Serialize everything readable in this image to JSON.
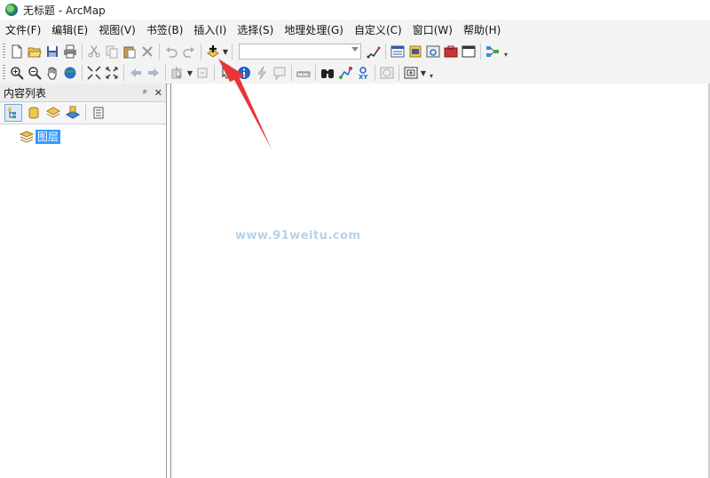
{
  "window": {
    "title": "无标题 - ArcMap",
    "app_icon": "arcmap-globe-icon"
  },
  "menubar": {
    "items": [
      "文件(F)",
      "编辑(E)",
      "视图(V)",
      "书签(B)",
      "插入(I)",
      "选择(S)",
      "地理处理(G)",
      "自定义(C)",
      "窗口(W)",
      "帮助(H)"
    ]
  },
  "toolbar_standard": {
    "scale_value": "",
    "icons": [
      "new-document-icon",
      "open-icon",
      "save-icon",
      "print-icon",
      "cut-icon",
      "copy-icon",
      "paste-icon",
      "delete-icon",
      "undo-icon",
      "redo-icon",
      "add-data-icon",
      "editor-icon",
      "table-of-contents-icon",
      "catalog-icon",
      "search-icon",
      "arctoolbox-icon",
      "python-icon",
      "model-builder-icon"
    ]
  },
  "toolbar_tools": {
    "icons": [
      "zoom-in-icon",
      "zoom-out-icon",
      "pan-icon",
      "full-extent-icon",
      "fixed-zoom-in-icon",
      "fixed-zoom-out-icon",
      "back-icon",
      "forward-icon",
      "select-features-icon",
      "clear-selection-icon",
      "select-elements-icon",
      "identify-icon",
      "hyperlink-icon",
      "html-popup-icon",
      "measure-icon",
      "find-icon",
      "find-route-icon",
      "go-to-xy-icon",
      "time-slider-icon",
      "create-viewer-icon"
    ]
  },
  "toc": {
    "title": "内容列表",
    "pin_glyph": "ᵖ",
    "close_glyph": "✕",
    "layer_label": "图层"
  },
  "map": {
    "watermark": "www.91weitu.com"
  },
  "colors": {
    "selection": "#3399ff",
    "annotation_arrow": "#e8353a",
    "watermark": "#b8d2ea"
  }
}
